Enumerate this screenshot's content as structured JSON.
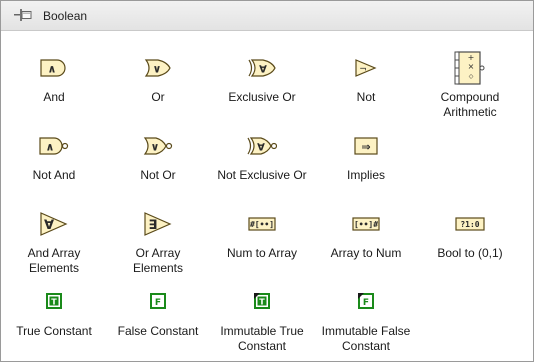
{
  "header": {
    "title": "Boolean"
  },
  "functions": [
    {
      "label": "And",
      "icon": "and-gate-icon"
    },
    {
      "label": "Or",
      "icon": "or-gate-icon"
    },
    {
      "label": "Exclusive Or",
      "icon": "xor-gate-icon"
    },
    {
      "label": "Not",
      "icon": "not-gate-icon"
    },
    {
      "label": "Compound\nArithmetic",
      "icon": "compound-arithmetic-icon"
    },
    {
      "label": "Not And",
      "icon": "nand-gate-icon"
    },
    {
      "label": "Not Or",
      "icon": "nor-gate-icon"
    },
    {
      "label": "Not Exclusive Or",
      "icon": "xnor-gate-icon"
    },
    {
      "label": "Implies",
      "icon": "implies-icon"
    },
    {
      "label": "And Array\nElements",
      "icon": "and-array-elements-icon"
    },
    {
      "label": "Or Array\nElements",
      "icon": "or-array-elements-icon"
    },
    {
      "label": "Num to Array",
      "icon": "num-to-array-icon"
    },
    {
      "label": "Array to Num",
      "icon": "array-to-num-icon"
    },
    {
      "label": "Bool to (0,1)",
      "icon": "bool-to-01-icon"
    },
    {
      "label": "True Constant",
      "icon": "true-constant-icon"
    },
    {
      "label": "False Constant",
      "icon": "false-constant-icon"
    },
    {
      "label": "Immutable True\nConstant",
      "icon": "immutable-true-constant-icon"
    },
    {
      "label": "Immutable False\nConstant",
      "icon": "immutable-false-constant-icon"
    }
  ],
  "icon_glyphs": {
    "and": "∧",
    "or": "∨",
    "xor": "∀",
    "not": "¬",
    "nand": "∧",
    "nor": "∨",
    "xnor": "∀",
    "implies": "⇒",
    "num_to_array": "#[••]",
    "array_to_num": "[••]#",
    "bool_to_01": "?1:0",
    "true_letter": "T",
    "false_letter": "F"
  },
  "colors": {
    "gate_fill": "#fdf2c4",
    "gate_stroke": "#5a4a1a",
    "constant_green": "#1a8a1a"
  }
}
